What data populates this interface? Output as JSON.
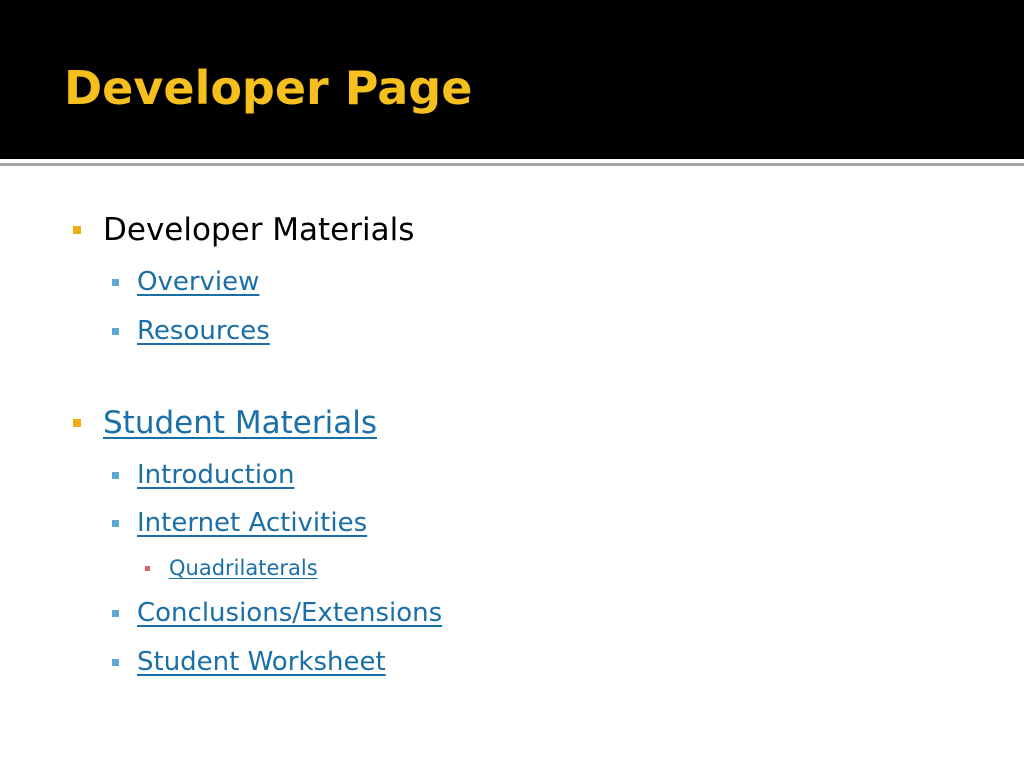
{
  "slide": {
    "title": "Developer Page",
    "colors": {
      "title_band": "#000000",
      "title_text": "#f5bf1d",
      "level1_marker": "#f0ae15",
      "level2_marker": "#5fa8d3",
      "level3_marker": "#e0606e",
      "link": "#1a6fa8"
    },
    "bullets": {
      "developer_materials": {
        "label": "Developer Materials",
        "items": [
          {
            "label": "Overview"
          },
          {
            "label": "Resources"
          }
        ]
      },
      "student_materials": {
        "label": "Student Materials",
        "items": [
          {
            "label": "Introduction"
          },
          {
            "label": "Internet Activities",
            "subitems": [
              {
                "label": "Quadrilaterals"
              }
            ]
          },
          {
            "label": "Conclusions/Extensions"
          },
          {
            "label": "Student Worksheet"
          }
        ]
      }
    }
  }
}
